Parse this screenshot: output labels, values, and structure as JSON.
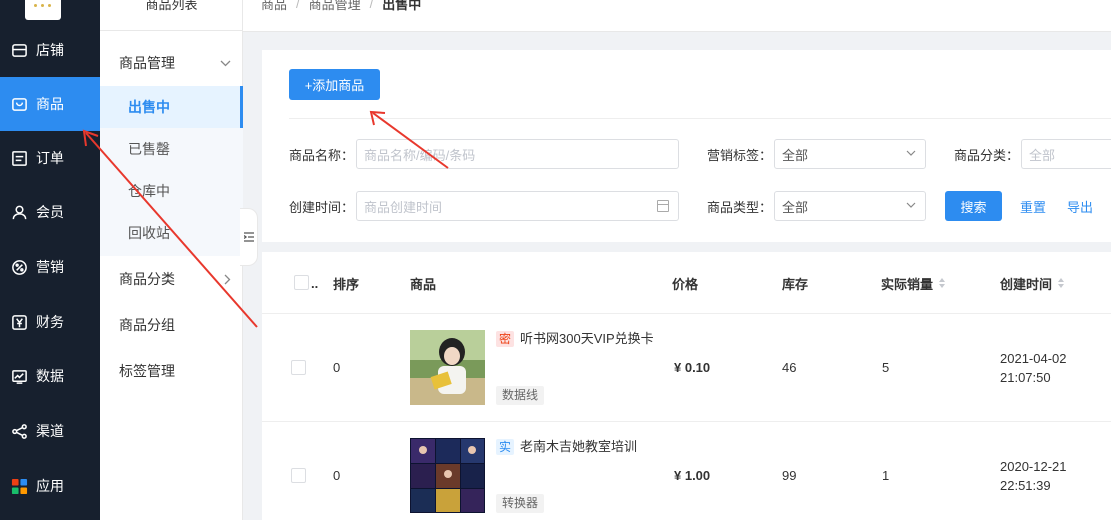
{
  "nav": {
    "items": [
      {
        "label": "店铺",
        "icon": "store-icon"
      },
      {
        "label": "商品",
        "icon": "bag-icon"
      },
      {
        "label": "订单",
        "icon": "order-icon"
      },
      {
        "label": "会员",
        "icon": "user-icon"
      },
      {
        "label": "营销",
        "icon": "discount-icon"
      },
      {
        "label": "财务",
        "icon": "yen-icon"
      },
      {
        "label": "数据",
        "icon": "chart-icon"
      },
      {
        "label": "渠道",
        "icon": "share-icon"
      },
      {
        "label": "应用",
        "icon": "apps-icon"
      }
    ],
    "active_color": "#2d8cf0"
  },
  "subnav": {
    "title": "商品列表",
    "group_manage": "商品管理",
    "items": [
      "出售中",
      "已售罄",
      "仓库中",
      "回收站"
    ],
    "group_category": "商品分类",
    "group_group": "商品分组",
    "group_tags": "标签管理"
  },
  "breadcrumb": [
    "商品",
    "商品管理",
    "出售中"
  ],
  "toolbar": {
    "add_label": "+添加商品"
  },
  "filters": {
    "name_label": "商品名称：",
    "name_placeholder": "商品名称/编码/条码",
    "marketing_label": "营销标签：",
    "marketing_value": "全部",
    "category_label": "商品分类：",
    "category_value": "全部",
    "created_label": "创建时间：",
    "created_placeholder": "商品创建时间",
    "type_label": "商品类型：",
    "type_value": "全部",
    "search_label": "搜索",
    "reset_label": "重置",
    "export_label": "导出"
  },
  "table": {
    "headers": {
      "select": "..",
      "order": "排序",
      "product": "商品",
      "price": "价格",
      "stock": "库存",
      "sales": "实际销量",
      "created": "创建时间"
    },
    "rows": [
      {
        "order": "0",
        "tag": "密",
        "name": "听书网300天VIP兑换卡",
        "sub_tag": "数据线",
        "price": "¥ 0.10",
        "stock": "46",
        "sales": "5",
        "date": "2021-04-02",
        "time": "21:07:50"
      },
      {
        "order": "0",
        "tag": "实",
        "name": "老南木吉她教室培训",
        "sub_tag": "转换器",
        "price": "¥ 1.00",
        "stock": "99",
        "sales": "1",
        "date": "2020-12-21",
        "time": "22:51:39"
      }
    ]
  }
}
